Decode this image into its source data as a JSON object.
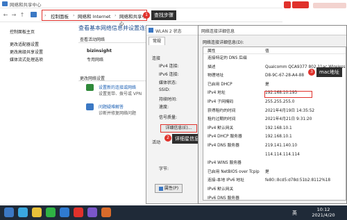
{
  "window": {
    "title": "网络和共享中心"
  },
  "breadcrumb": {
    "p1": "控制面板",
    "sep": "›",
    "p2": "网络和 Internet",
    "p3": "网络和共享中心"
  },
  "annotations": {
    "n1": "1",
    "l1": "查找步骤",
    "n2": "2",
    "l2": "详细星信息",
    "n3": "3",
    "l3": "mac地址"
  },
  "left": {
    "home": "控制面板主页",
    "items": [
      "更改适配器设置",
      "更改高级共享设置",
      "媒体流式处理选项"
    ]
  },
  "center": {
    "title": "查看基本网络信息并设置连接",
    "active_label": "查看活动网络",
    "net_name": "bizinsight",
    "net_type": "专用网络",
    "change_label": "更改网络设置",
    "new_link": "设置新的连接或网络",
    "new_desc": "设置宽带、拨号或 VPN",
    "trouble_link": "问题疑难解答",
    "trouble_desc": "诊断并修复网络问题"
  },
  "wlan": {
    "title": "WLAN 2 状态",
    "tab": "常规",
    "conn": "连接",
    "rows": [
      "IPv4 连接:",
      "IPv6 连接:",
      "媒体状态:",
      "SSID:",
      "持续时间:",
      "速度:"
    ],
    "signal": "信号质量:",
    "details_btn": "详细信息(E)...",
    "activity": "活动",
    "bytes": "字节:",
    "props_btn": "属性(P)"
  },
  "details": {
    "title": "网络连接详细信息",
    "subtitle": "网络连接详细信息(D):",
    "col_prop": "属性",
    "col_val": "值",
    "rows": [
      [
        "连接特定的 DNS 后缀",
        ""
      ],
      [
        "描述",
        "Qualcomm QCA9377 802.11ac Wireless"
      ],
      [
        "物理地址",
        "D8-9C-67-28-A4-88"
      ],
      [
        "已启用 DHCP",
        "是"
      ],
      [
        "IPv4 地址",
        "192.168.10.193"
      ],
      [
        "IPv4 子网掩码",
        "255.255.255.0"
      ],
      [
        "获得租约的时间",
        "2021年4月19日 14:35:52"
      ],
      [
        "租约过期的时间",
        "2021年4月21日 9:31:20"
      ],
      [
        "IPv4 默认网关",
        "192.168.10.1"
      ],
      [
        "IPv4 DHCP 服务器",
        "192.168.10.1"
      ],
      [
        "IPv4 DNS 服务器",
        "219.141.140.10"
      ],
      [
        "",
        "114.114.114.114"
      ],
      [
        "IPv4 WINS 服务器",
        ""
      ],
      [
        "已启用 NetBIOS over Tcpip",
        "是"
      ],
      [
        "连接-本地 IPv6 地址",
        "fe80::8cd5:d78d:51b2:8112%18"
      ],
      [
        "IPv6 默认网关",
        ""
      ],
      [
        "IPv6 DNS 服务器",
        ""
      ]
    ]
  },
  "taskbar": {
    "lang": "英",
    "time": "10:12",
    "date": "2021/4/20"
  },
  "colors": {
    "accent_red": "#e0312b",
    "link_blue": "#1a5fb4",
    "taskbar": "#1f2a38"
  }
}
